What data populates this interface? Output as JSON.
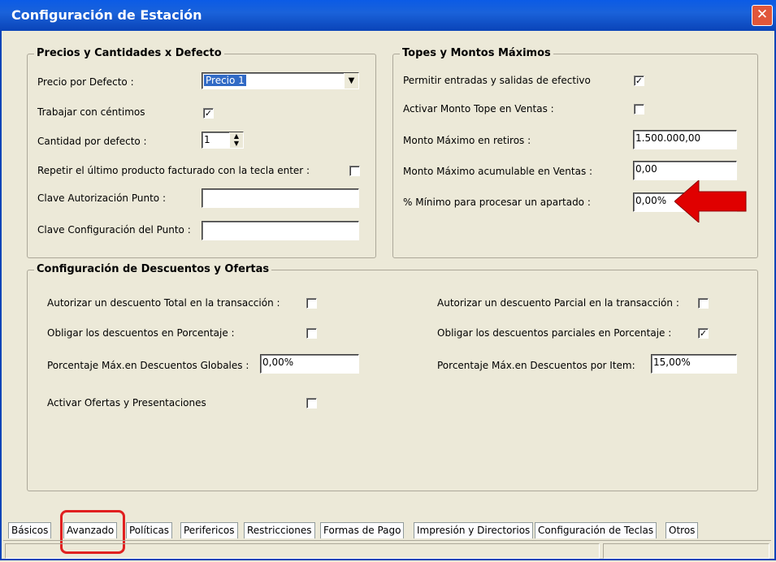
{
  "window": {
    "title": "Configuración de Estación",
    "close_icon": "close-icon"
  },
  "precios": {
    "legend": "Precios y Cantidades x Defecto",
    "precio_label": "Precio por Defecto :",
    "precio_value": "Precio 1",
    "centimos_label": "Trabajar con céntimos",
    "centimos_checked": "✓",
    "cantidad_label": "Cantidad por defecto :",
    "cantidad_value": "1",
    "repetir_label": "Repetir el último producto facturado con la tecla enter :",
    "clave_aut_label": "Clave Autorización Punto :",
    "clave_aut_value": "",
    "clave_conf_label": "Clave Configuración del  Punto :",
    "clave_conf_value": ""
  },
  "topes": {
    "legend": "Topes y Montos Máximos",
    "permitir_label": "Permitir entradas y salidas de efectivo",
    "permitir_checked": "✓",
    "activar_label": "Activar Monto Tope en Ventas :",
    "retiros_label": "Monto Máximo en retiros :",
    "retiros_value": "1.500.000,00",
    "acumulable_label": "Monto Máximo acumulable en Ventas :",
    "acumulable_value": "0,00",
    "apartado_label": "% Mínimo para procesar un apartado :",
    "apartado_value": "0,00%",
    "arrow_color": "#e00000"
  },
  "descuentos": {
    "legend": "Configuración de Descuentos y Ofertas",
    "total_label": "Autorizar un descuento Total en la transacción :",
    "parcial_label": "Autorizar un descuento Parcial en la transacción :",
    "obligar_label": "Obligar los descuentos en Porcentaje :",
    "obligar_parciales_label": "Obligar los descuentos parciales en Porcentaje :",
    "obligar_parciales_checked": "✓",
    "globales_label": "Porcentaje Máx.en Descuentos Globales :",
    "globales_value": "0,00%",
    "item_label": "Porcentaje Máx.en Descuentos por Item:",
    "item_value": "15,00%",
    "ofertas_label": "Activar Ofertas y Presentaciones"
  },
  "tabs": [
    "Básicos",
    "Avanzado",
    "Políticas",
    "Perifericos",
    "Restricciones",
    "Formas de Pago",
    "Impresión y Directorios",
    "Configuración de Teclas",
    "Otros"
  ],
  "active_tab": "Avanzado",
  "highlight_color": "#e02020"
}
